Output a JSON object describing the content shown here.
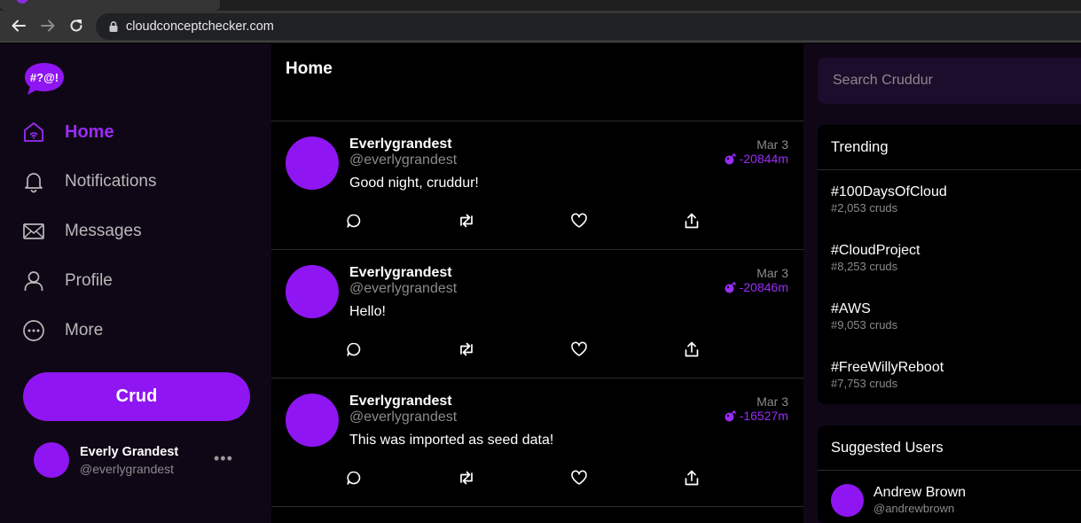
{
  "browser": {
    "url": "cloudconceptchecker.com"
  },
  "colors": {
    "accent": "#8f16f2",
    "accent_text": "#9a2cf7",
    "sidebar_bg": "#0f0716",
    "feed_bg": "#000000"
  },
  "sidebar": {
    "logo_text": "#?@!",
    "items": [
      {
        "label": "Home",
        "icon": "home-icon",
        "active": true
      },
      {
        "label": "Notifications",
        "icon": "bell-icon",
        "active": false
      },
      {
        "label": "Messages",
        "icon": "envelope-icon",
        "active": false
      },
      {
        "label": "Profile",
        "icon": "user-icon",
        "active": false
      },
      {
        "label": "More",
        "icon": "more-circle-icon",
        "active": false
      }
    ],
    "crud_button": "Crud",
    "current_user": {
      "display_name": "Everly Grandest",
      "handle": "@everlygrandest",
      "menu": "•••"
    }
  },
  "main": {
    "title": "Home",
    "posts": [
      {
        "display_name": "Everlygrandest",
        "handle": "@everlygrandest",
        "message": "Good night, cruddur!",
        "date": "Mar 3",
        "expires": "-20844m"
      },
      {
        "display_name": "Everlygrandest",
        "handle": "@everlygrandest",
        "message": "Hello!",
        "date": "Mar 3",
        "expires": "-20846m"
      },
      {
        "display_name": "Everlygrandest",
        "handle": "@everlygrandest",
        "message": "This was imported as seed data!",
        "date": "Mar 3",
        "expires": "-16527m"
      }
    ]
  },
  "right": {
    "search_placeholder": "Search Cruddur",
    "trending": {
      "title": "Trending",
      "items": [
        {
          "name": "#100DaysOfCloud",
          "count": "#2,053 cruds"
        },
        {
          "name": "#CloudProject",
          "count": "#8,253 cruds"
        },
        {
          "name": "#AWS",
          "count": "#9,053 cruds"
        },
        {
          "name": "#FreeWillyReboot",
          "count": "#7,753 cruds"
        }
      ]
    },
    "suggested": {
      "title": "Suggested Users",
      "users": [
        {
          "display_name": "Andrew Brown",
          "handle": "@andrewbrown"
        }
      ]
    }
  }
}
